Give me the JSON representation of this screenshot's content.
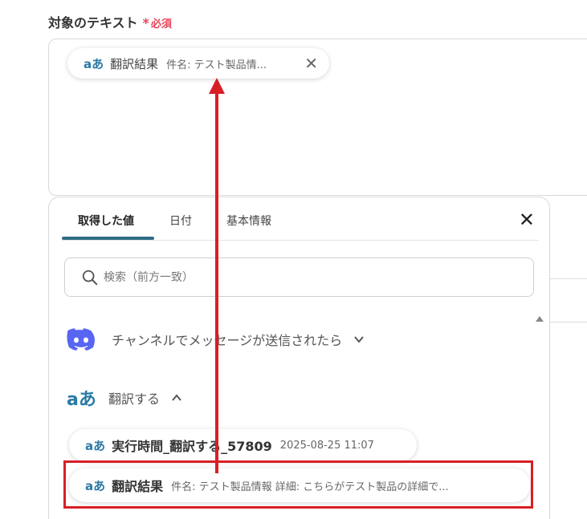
{
  "field": {
    "label": "対象のテキスト",
    "required_star": "*",
    "required_text": "必須"
  },
  "selected_chip": {
    "icon": "translate-icon",
    "icon_glyph": "aあ",
    "name": "翻訳結果",
    "value": "件名: テスト製品情...",
    "close_glyph": "✕"
  },
  "panel": {
    "tabs": [
      {
        "label": "取得した値",
        "active": true
      },
      {
        "label": "日付",
        "active": false
      },
      {
        "label": "基本情報",
        "active": false
      }
    ],
    "close_glyph": "✕",
    "search": {
      "placeholder": "検索（前方一致）"
    },
    "sections": [
      {
        "label": "チャンネルでメッセージが送信されたら",
        "icon": "discord-icon",
        "expanded": false
      },
      {
        "label": "翻訳する",
        "icon": "translate-icon",
        "icon_glyph": "aあ",
        "expanded": true
      }
    ],
    "items": [
      {
        "icon_glyph": "aあ",
        "name": "実行時間_翻訳する_57809",
        "value": "2025-08-25 11:07"
      },
      {
        "icon_glyph": "aあ",
        "name": "翻訳結果",
        "value": "件名: テスト製品情報 詳細: こちらがテスト製品の詳細で..."
      }
    ]
  },
  "colors": {
    "accent": "#2f6d85",
    "required": "#e8455a",
    "highlight": "#d81f26",
    "discord": "#5865f2"
  }
}
